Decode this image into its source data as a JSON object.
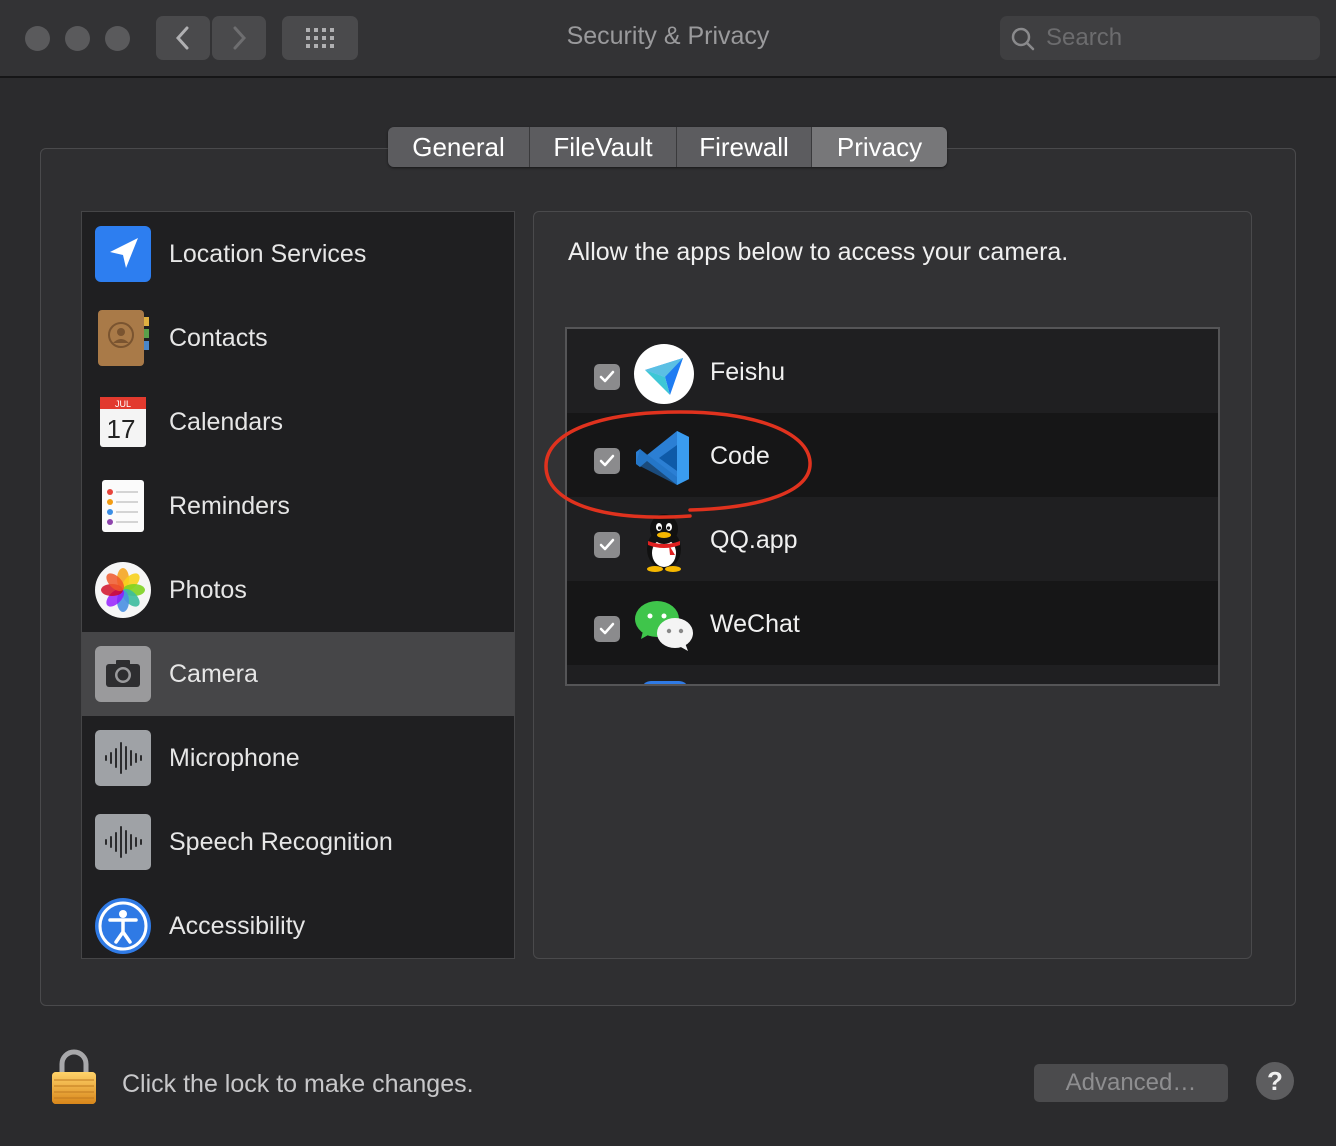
{
  "window": {
    "title": "Security & Privacy"
  },
  "search": {
    "placeholder": "Search"
  },
  "tabs": [
    {
      "label": "General",
      "selected": false
    },
    {
      "label": "FileVault",
      "selected": false
    },
    {
      "label": "Firewall",
      "selected": false
    },
    {
      "label": "Privacy",
      "selected": true
    }
  ],
  "sidebar": {
    "items": [
      {
        "label": "Location Services",
        "icon": "location-icon"
      },
      {
        "label": "Contacts",
        "icon": "contacts-icon"
      },
      {
        "label": "Calendars",
        "icon": "calendar-icon",
        "icon_month": "JUL",
        "icon_day": "17"
      },
      {
        "label": "Reminders",
        "icon": "reminders-icon"
      },
      {
        "label": "Photos",
        "icon": "photos-icon"
      },
      {
        "label": "Camera",
        "icon": "camera-icon",
        "selected": true
      },
      {
        "label": "Microphone",
        "icon": "microphone-icon"
      },
      {
        "label": "Speech Recognition",
        "icon": "speech-recognition-icon"
      },
      {
        "label": "Accessibility",
        "icon": "accessibility-icon"
      }
    ]
  },
  "main": {
    "description": "Allow the apps below to access your camera.",
    "apps": [
      {
        "name": "Feishu",
        "checked": true,
        "icon": "feishu-icon"
      },
      {
        "name": "Code",
        "checked": true,
        "icon": "vscode-icon"
      },
      {
        "name": "QQ.app",
        "checked": true,
        "icon": "qq-icon"
      },
      {
        "name": "WeChat",
        "checked": true,
        "icon": "wechat-icon"
      }
    ]
  },
  "footer": {
    "lock_text": "Click the lock to make changes.",
    "advanced_label": "Advanced…",
    "help_label": "?"
  },
  "colors": {
    "window_bg": "#2b2b2d",
    "selected_row": "#464648",
    "annotation": "#e0321e"
  }
}
